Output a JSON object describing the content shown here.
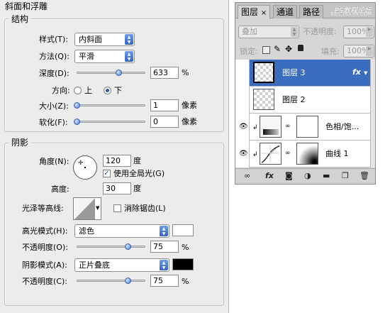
{
  "bevel": {
    "title": "斜面和浮雕",
    "structure": {
      "title": "结构",
      "style_label": "样式(T):",
      "style_value": "内斜面",
      "technique_label": "方法(Q):",
      "technique_value": "平滑",
      "depth_label": "深度(D):",
      "depth_value": "633",
      "depth_unit": "%",
      "depth_slider_fraction": 0.6,
      "direction_label": "方向:",
      "direction_up": "上",
      "direction_down": "下",
      "direction_selected": "down",
      "size_label": "大小(Z):",
      "size_value": "1",
      "size_unit": "像素",
      "soften_label": "软化(F):",
      "soften_value": "0",
      "soften_unit": "像素"
    },
    "shading": {
      "title": "阴影",
      "angle_label": "角度(N):",
      "angle_value": "120",
      "angle_unit": "度",
      "global_light_label": "使用全局光(G)",
      "global_light_checked": true,
      "altitude_label": "高度:",
      "altitude_value": "30",
      "altitude_unit": "度",
      "gloss_contour_label": "光泽等高线:",
      "antialias_label": "消除锯齿(L)",
      "antialias_checked": false,
      "highlight_mode_label": "高光模式(H):",
      "highlight_mode_value": "滤色",
      "highlight_color": "#ffffff",
      "highlight_opacity_label": "不透明度(O):",
      "highlight_opacity_value": "75",
      "highlight_opacity_unit": "%",
      "shadow_mode_label": "阴影模式(A):",
      "shadow_mode_value": "正片叠底",
      "shadow_color": "#000000",
      "shadow_opacity_label": "不透明度(C):",
      "shadow_opacity_value": "75",
      "shadow_opacity_unit": "%"
    }
  },
  "layers_panel": {
    "tabs": [
      "图层",
      "通道",
      "路径"
    ],
    "tab_close": "×",
    "watermark": "PS教程论坛",
    "watermark_sub": "BBS.16XX8.COM",
    "blend_mode": "叠加",
    "opacity_label": "不透明度:",
    "opacity_value": "100%",
    "lock_label": "锁定:",
    "fill_label": "填充:",
    "fill_value": "100%",
    "layers": [
      {
        "name": "图层 3",
        "selected": true,
        "fx": "fx"
      },
      {
        "name": "图层 2",
        "selected": false
      },
      {
        "name": "色相/饱...",
        "selected": false
      },
      {
        "name": "曲线 1",
        "selected": false
      }
    ],
    "accent": "#3a6cc0"
  }
}
